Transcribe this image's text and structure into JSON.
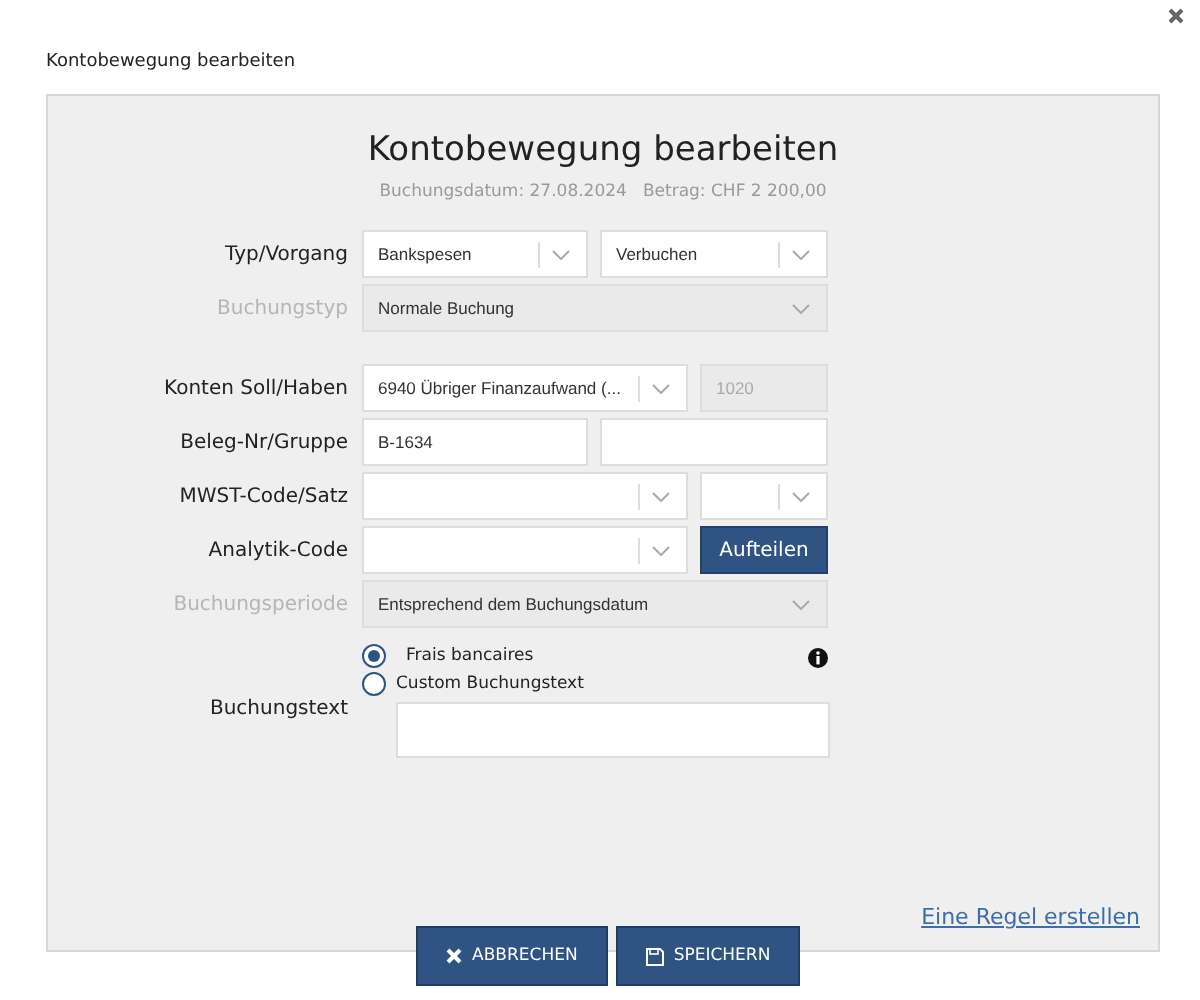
{
  "dialog": {
    "title": "Kontobewegung bearbeiten"
  },
  "panel": {
    "heading": "Kontobewegung bearbeiten",
    "date": "Buchungsdatum: 27.08.2024",
    "amount": "Betrag: CHF 2 200,00"
  },
  "rows": [
    {
      "label": "Typ/Vorgang",
      "disabled": false,
      "kind": "pair",
      "controls": [
        {
          "kind": "select",
          "value": "Bankspesen",
          "disabled": false
        },
        {
          "kind": "select",
          "value": "Verbuchen",
          "disabled": false
        }
      ]
    },
    {
      "label": "Buchungstyp",
      "disabled": true,
      "kind": "single",
      "controls": [
        {
          "kind": "select",
          "value": "Normale Buchung",
          "disabled": true
        }
      ]
    },
    {
      "label": "Konten Soll/Haben",
      "disabled": false,
      "kind": "main-side",
      "controls": [
        {
          "kind": "select",
          "value": "6940 Übriger Finanzaufwand (...",
          "disabled": false
        },
        {
          "kind": "input",
          "placeholder": "1020",
          "disabled": true
        }
      ]
    },
    {
      "label": "Beleg-Nr/Gruppe",
      "disabled": false,
      "kind": "pair",
      "controls": [
        {
          "kind": "input",
          "value": "B-1634",
          "disabled": false
        },
        {
          "kind": "input",
          "disabled": false
        }
      ]
    },
    {
      "label": "MWST-Code/Satz",
      "disabled": false,
      "kind": "main-side",
      "controls": [
        {
          "kind": "select",
          "disabled": false
        },
        {
          "kind": "select",
          "disabled": false
        }
      ]
    },
    {
      "label": "Analytik-Code",
      "disabled": false,
      "kind": "main-side",
      "controls": [
        {
          "kind": "select",
          "disabled": false
        },
        {
          "kind": "button",
          "value": "Aufteilen"
        }
      ]
    },
    {
      "label": "Buchungsperiode",
      "disabled": true,
      "kind": "single",
      "controls": [
        {
          "kind": "select",
          "value": "Entsprechend dem Buchungsdatum",
          "disabled": true
        }
      ]
    }
  ],
  "buchungstext": {
    "label": "Buchungstext",
    "options": [
      {
        "label": "Frais bancaires",
        "selected": true
      },
      {
        "label": "Custom Buchungstext",
        "selected": false
      }
    ]
  },
  "rule_link": "Eine Regel erstellen",
  "buttons": [
    {
      "kind": "cancel",
      "label": "ABBRECHEN"
    },
    {
      "kind": "save",
      "label": "SPEICHERN"
    }
  ]
}
